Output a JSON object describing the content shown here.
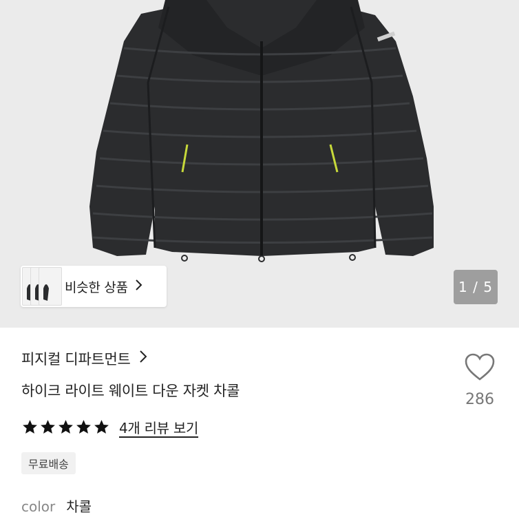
{
  "hero": {
    "similar_label": "비슷한 상품",
    "pager": "1 / 5"
  },
  "product": {
    "brand": "피지컬 디파트먼트",
    "title": "하이크 라이트 웨이트 다운 자켓 차콜",
    "like_count": "286",
    "rating_stars": 5,
    "review_link": "4개 리뷰 보기",
    "shipping_badge": "무료배송",
    "color_label": "color",
    "color_value": "차콜"
  },
  "icons": {
    "like": "heart-outline-icon",
    "chevron": "chevron-right-icon",
    "star": "star-filled-icon"
  },
  "colors": {
    "hero_bg": "#ebebeb",
    "jacket": "#2b2c2e",
    "zip_accent": "#c7d93a",
    "pager_bg": "#9e9e9e",
    "badge_bg": "#f1f1f1"
  }
}
